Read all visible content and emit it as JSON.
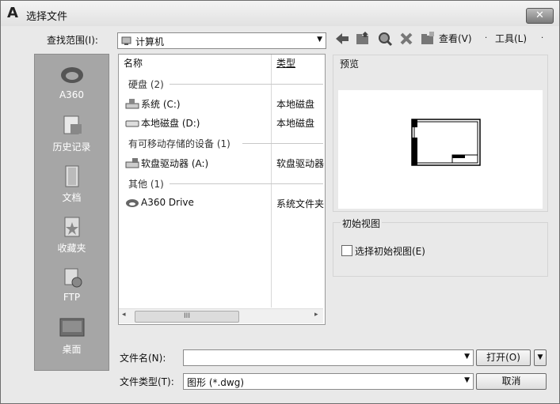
{
  "window": {
    "title": "选择文件",
    "close_label": "✕"
  },
  "lookin": {
    "label": "查找范围(I):",
    "value": "计算机"
  },
  "toolbar": {
    "view_label": "查看(V)",
    "tools_label": "工具(L)"
  },
  "places": [
    {
      "label": "A360",
      "icon": "a360-icon"
    },
    {
      "label": "历史记录",
      "icon": "history-icon"
    },
    {
      "label": "文档",
      "icon": "documents-icon"
    },
    {
      "label": "收藏夹",
      "icon": "favorites-icon"
    },
    {
      "label": "FTP",
      "icon": "ftp-icon"
    },
    {
      "label": "桌面",
      "icon": "desktop-icon"
    }
  ],
  "filelist": {
    "col_name": "名称",
    "col_type": "类型",
    "groups": [
      {
        "label": "硬盘 (2)"
      },
      {
        "label": "有可移动存储的设备 (1)"
      },
      {
        "label": "其他 (1)"
      }
    ],
    "rows": [
      {
        "name": "系统 (C:)",
        "type": "本地磁盘"
      },
      {
        "name": "本地磁盘 (D:)",
        "type": "本地磁盘"
      },
      {
        "name": "软盘驱动器 (A:)",
        "type": "软盘驱动器"
      },
      {
        "name": "A360 Drive",
        "type": "系统文件夹"
      }
    ],
    "scroll_thumb": "III"
  },
  "preview": {
    "label": "预览"
  },
  "initial_view": {
    "group_label": "初始视图",
    "checkbox_label": "选择初始视图(E)",
    "checked": false
  },
  "filename": {
    "label": "文件名(N):",
    "value": ""
  },
  "filetype": {
    "label": "文件类型(T):",
    "value": "图形 (*.dwg)"
  },
  "buttons": {
    "open": "打开(O)",
    "cancel": "取消"
  }
}
